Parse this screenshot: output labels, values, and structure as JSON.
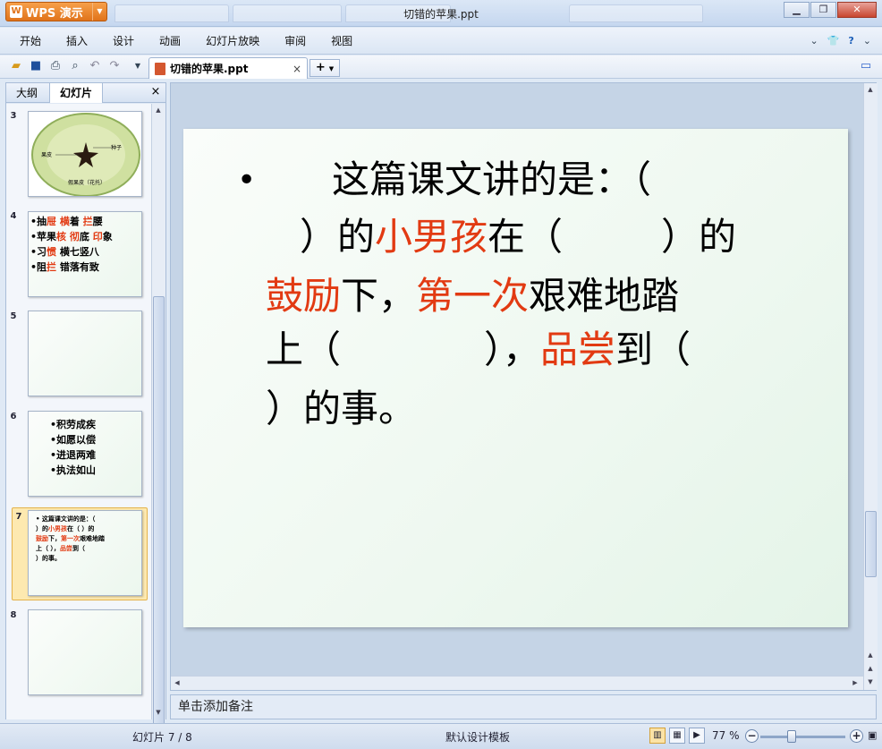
{
  "app": {
    "name": "WPS 演示",
    "window_title": "切错的苹果.ppt"
  },
  "menu": [
    "开始",
    "插入",
    "设计",
    "动画",
    "幻灯片放映",
    "审阅",
    "视图"
  ],
  "toolbar": {
    "doc_tab_label": "切错的苹果.ppt",
    "close_glyph": "×",
    "new_tab_glyph": "+"
  },
  "panel": {
    "tab_outline": "大纲",
    "tab_slides": "幻灯片",
    "close_glyph": "×"
  },
  "thumbnails": [
    {
      "num": "3",
      "labels": {
        "left": "果皮",
        "right": "种子",
        "bottom": "假果皮（花托）"
      }
    },
    {
      "num": "4",
      "lines": [
        [
          {
            "t": "•抽"
          },
          {
            "t": "屉",
            "r": true
          },
          {
            "t": "  "
          },
          {
            "t": "横",
            "r": true
          },
          {
            "t": "着 "
          },
          {
            "t": "拦",
            "r": true
          },
          {
            "t": "腰"
          }
        ],
        [
          {
            "t": "•苹果"
          },
          {
            "t": "核",
            "r": true
          },
          {
            "t": " "
          },
          {
            "t": "彻",
            "r": true
          },
          {
            "t": "底 "
          },
          {
            "t": "印",
            "r": true
          },
          {
            "t": "象"
          }
        ],
        [
          {
            "t": "•习"
          },
          {
            "t": "惯",
            "r": true
          },
          {
            "t": "  横七竖八"
          }
        ],
        [
          {
            "t": "•阻"
          },
          {
            "t": "拦",
            "r": true
          },
          {
            "t": "  错落有致"
          }
        ]
      ]
    },
    {
      "num": "5"
    },
    {
      "num": "6",
      "lines": [
        "•积劳成疾",
        "•如愿以偿",
        "•进退两难",
        "•执法如山"
      ]
    },
    {
      "num": "7",
      "lines": [
        [
          {
            "t": "•    这篇课文讲的是：（"
          }
        ],
        [
          {
            "t": "    ）的"
          },
          {
            "t": "小男孩",
            "r": true
          },
          {
            "t": "在（     ）的"
          }
        ],
        [
          {
            "t": "鼓励",
            "r": true
          },
          {
            "t": "下，"
          },
          {
            "t": "第一次",
            "r": true
          },
          {
            "t": "艰难地踏"
          }
        ],
        [
          {
            "t": "上（      ），"
          },
          {
            "t": "品尝",
            "r": true
          },
          {
            "t": "到（"
          }
        ],
        [
          {
            "t": "）的事。"
          }
        ]
      ]
    },
    {
      "num": "8"
    }
  ],
  "slide": {
    "bullet": "•",
    "lines": [
      [
        {
          "t": "这篇课文讲的是：（"
        }
      ],
      [
        {
          "t": "）的"
        },
        {
          "t": "小男孩",
          "r": true
        },
        {
          "t": "在（"
        },
        {
          "t": "）的"
        }
      ],
      [
        {
          "t": "鼓励",
          "r": true
        },
        {
          "t": "下，"
        },
        {
          "t": "第一次",
          "r": true
        },
        {
          "t": "艰难地踏"
        }
      ],
      [
        {
          "t": "上（"
        },
        {
          "t": "），"
        },
        {
          "t": "品尝",
          "r": true
        },
        {
          "t": "到（"
        }
      ],
      [
        {
          "t": "）的事。"
        }
      ]
    ]
  },
  "notes_placeholder": "单击添加备注",
  "status": {
    "slide_indicator": "幻灯片 7 / 8",
    "template": "默认设计模板",
    "zoom": "77 %"
  },
  "colors": {
    "accent_red": "#e23a12",
    "wps_orange": "#e0731a"
  }
}
